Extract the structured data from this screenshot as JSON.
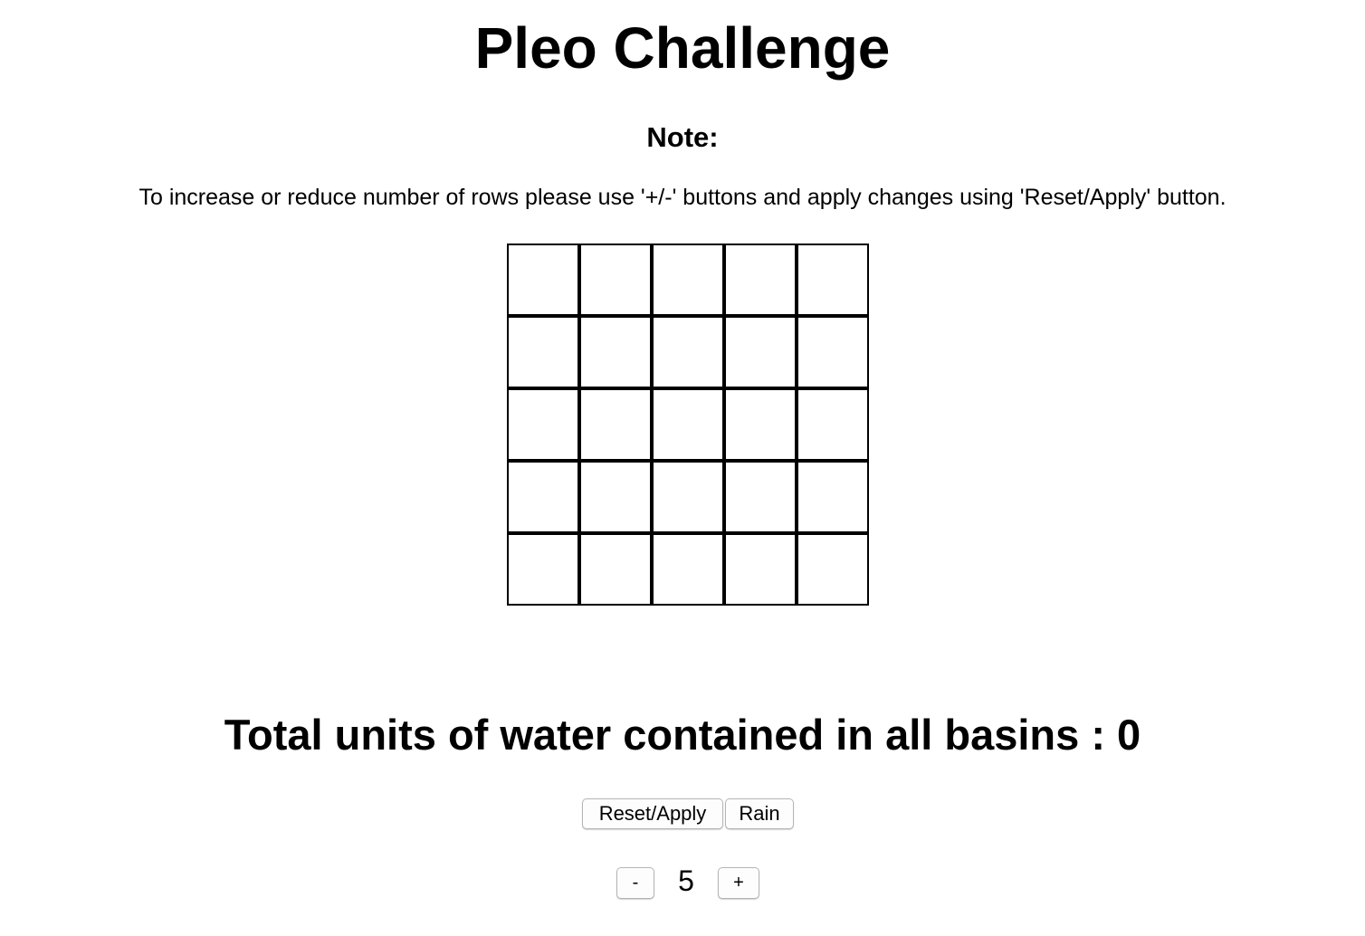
{
  "page": {
    "title": "Pleo Challenge",
    "note_heading": "Note:",
    "note_text": "To increase or reduce number of rows please use '+/-' buttons and apply changes using 'Reset/Apply' button."
  },
  "grid": {
    "rows": 5,
    "columns": 5,
    "cell_border_color": "#000000",
    "cell_fill_color": "#ffffff"
  },
  "result": {
    "label": "Total units of water contained in all basins : 0"
  },
  "actions": {
    "reset_apply_label": "Reset/Apply",
    "rain_label": "Rain"
  },
  "row_stepper": {
    "decrement_label": "-",
    "value": "5",
    "increment_label": "+"
  }
}
